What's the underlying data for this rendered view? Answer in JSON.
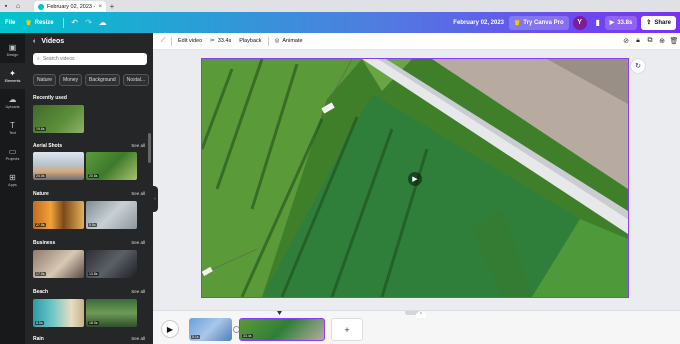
{
  "browser": {
    "tab_title": "February 02, 2023 - W...",
    "close_glyph": "×",
    "new_tab_glyph": "+"
  },
  "header": {
    "file_label": "File",
    "resize_label": "Resize",
    "doc_title": "February 02, 2023",
    "try_pro_label": "Try Canva Pro",
    "avatar_letter": "Y",
    "play_time": "33.8s",
    "share_label": "Share"
  },
  "rail": {
    "items": [
      {
        "label": "Design",
        "icon": "layout-icon"
      },
      {
        "label": "Elements",
        "icon": "shapes-icon"
      },
      {
        "label": "Uploads",
        "icon": "cloud-upload-icon"
      },
      {
        "label": "Text",
        "icon": "text-icon"
      },
      {
        "label": "Projects",
        "icon": "folder-icon"
      },
      {
        "label": "Apps",
        "icon": "grid-icon"
      }
    ]
  },
  "panel": {
    "title": "Videos",
    "search_placeholder": "Search videos",
    "chips": [
      "Nature",
      "Money",
      "Background",
      "Nostal..."
    ],
    "sections": {
      "recent": {
        "title": "Recently used",
        "durations": [
          "19.6s"
        ]
      },
      "aerial": {
        "title": "Aerial Shots",
        "see_all": "See all",
        "durations": [
          "24.0s",
          "20.6s"
        ]
      },
      "nature": {
        "title": "Nature",
        "see_all": "See all",
        "durations": [
          "27.5s",
          "5.0s"
        ]
      },
      "business": {
        "title": "Business",
        "see_all": "See all",
        "durations": [
          "17.0s",
          "13.8s"
        ]
      },
      "beach": {
        "title": "Beach",
        "see_all": "See all",
        "durations": [
          "8.5s",
          "18.0s"
        ]
      },
      "rain": {
        "title": "Rain",
        "see_all": "See all"
      }
    }
  },
  "toolbar": {
    "edit_video_label": "Edit video",
    "duration_label": "33.4s",
    "playback_label": "Playback",
    "animate_label": "Animate"
  },
  "timeline": {
    "clip1_duration": "5.1s",
    "clip2_duration": "33.4s",
    "add_glyph": "+"
  },
  "colors": {
    "accent": "#8b3dff",
    "header_start": "#00c4cc",
    "header_end": "#7b2ff7",
    "panel_bg": "#252627",
    "rail_bg": "#18191b"
  }
}
